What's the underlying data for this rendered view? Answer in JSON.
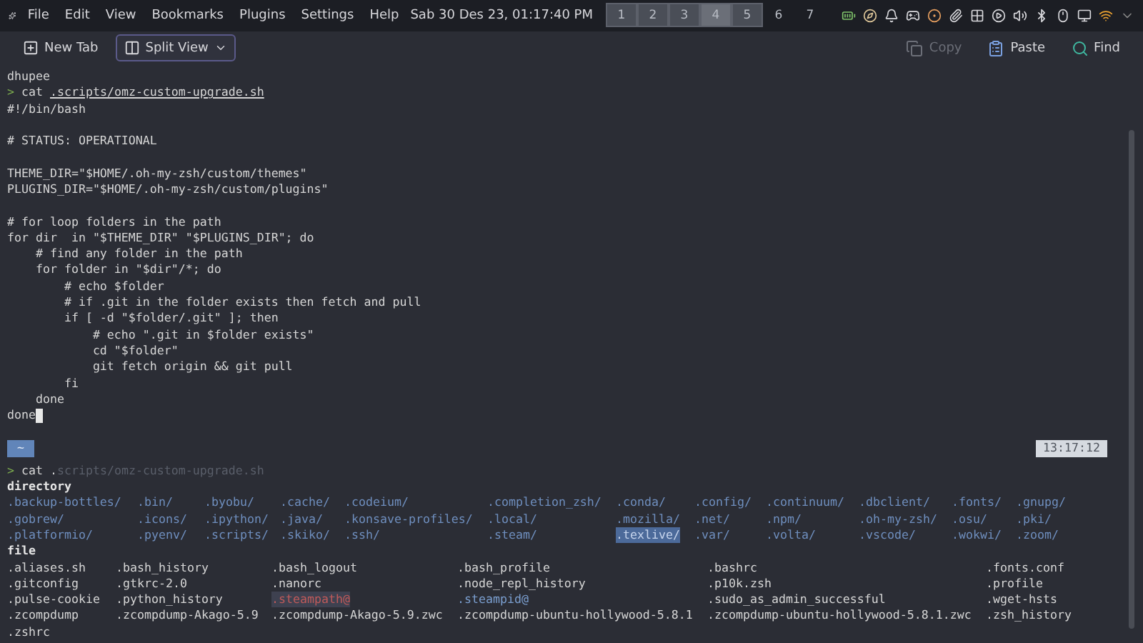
{
  "panel": {
    "menus": [
      "File",
      "Edit",
      "View",
      "Bookmarks",
      "Plugins",
      "Settings",
      "Help"
    ],
    "clock": "Sab 30 Des 23, 01:17:40 PM",
    "desktops": [
      {
        "label": "1",
        "occupied": true,
        "selected": false
      },
      {
        "label": "2",
        "occupied": true,
        "selected": false
      },
      {
        "label": "3",
        "occupied": true,
        "selected": false
      },
      {
        "label": "4",
        "occupied": true,
        "selected": true
      },
      {
        "label": "5",
        "occupied": true,
        "selected": false
      },
      {
        "label": "6",
        "occupied": false,
        "selected": false
      },
      {
        "label": "7",
        "occupied": false,
        "selected": false
      }
    ]
  },
  "toolbar": {
    "left": [
      {
        "label": "New Tab",
        "kind": "tab"
      },
      {
        "label": "Split View",
        "kind": "split"
      }
    ],
    "right": [
      {
        "label": "Copy",
        "kind": "copy",
        "disabled": true
      },
      {
        "label": "Paste",
        "kind": "paste",
        "disabled": false
      },
      {
        "label": "Find",
        "kind": "find",
        "disabled": false
      }
    ]
  },
  "terminal": {
    "user": "dhupee",
    "command": {
      "prompt": ">",
      "name": "cat",
      "argument": ".scripts/omz-custom-upgrade.sh"
    },
    "output": [
      [
        "#!/bin/bash"
      ],
      [
        "# STATUS: OPERATIONAL"
      ],
      [
        "THEME_DIR=\"$HOME/.oh-my-zsh/custom/themes\"",
        "PLUGINS_DIR=\"$HOME/.oh-my-zsh/custom/plugins\""
      ],
      [
        "# for loop folders in the path",
        "for dir  in \"$THEME_DIR\" \"$PLUGINS_DIR\"; do",
        "    # find any folder in the path",
        "    for folder in \"$dir\"/*; do",
        "        # echo $folder",
        "        # if .git in the folder exists then fetch and pull",
        "        if [ -d \"$folder/.git\" ]; then",
        "            # echo \".git in $folder exists\"",
        "            cd \"$folder\"",
        "            git fetch origin && git pull",
        "        fi",
        "    done",
        "done"
      ]
    ],
    "cursor": true,
    "path": "~",
    "time": "13:17:12",
    "next_command": {
      "prompt": ">",
      "name": "cat",
      "typed": ".",
      "suggestion": "scripts/omz-custom-upgrade.sh"
    },
    "directory_label": "directory",
    "directories": [
      {
        "name": ".backup-bottles/",
        "selected": false
      },
      {
        "name": ".bin/",
        "selected": false
      },
      {
        "name": ".byobu/",
        "selected": false
      },
      {
        "name": ".cache/",
        "selected": false
      },
      {
        "name": ".codeium/",
        "selected": false
      },
      {
        "name": ".completion_zsh/",
        "selected": false
      },
      {
        "name": ".conda/",
        "selected": false
      },
      {
        "name": ".config/",
        "selected": false
      },
      {
        "name": ".continuum/",
        "selected": false
      },
      {
        "name": ".dbclient/",
        "selected": false
      },
      {
        "name": ".fonts/",
        "selected": false
      },
      {
        "name": ".gnupg/",
        "selected": false
      },
      {
        "name": ".gobrew/",
        "selected": false
      },
      {
        "name": ".icons/",
        "selected": false
      },
      {
        "name": ".ipython/",
        "selected": false
      },
      {
        "name": ".java/",
        "selected": false
      },
      {
        "name": ".konsave-profiles/",
        "selected": false
      },
      {
        "name": ".local/",
        "selected": false
      },
      {
        "name": ".mozilla/",
        "selected": false
      },
      {
        "name": ".net/",
        "selected": false
      },
      {
        "name": ".npm/",
        "selected": false
      },
      {
        "name": ".oh-my-zsh/",
        "selected": false
      },
      {
        "name": ".osu/",
        "selected": false
      },
      {
        "name": ".pki/",
        "selected": false
      },
      {
        "name": ".platformio/",
        "selected": false
      },
      {
        "name": ".pyenv/",
        "selected": false
      },
      {
        "name": ".scripts/",
        "selected": false
      },
      {
        "name": ".skiko/",
        "selected": false
      },
      {
        "name": ".ssh/",
        "selected": false
      },
      {
        "name": ".steam/",
        "selected": false
      },
      {
        "name": ".texlive/",
        "selected": true
      },
      {
        "name": ".var/",
        "selected": false
      },
      {
        "name": ".volta/",
        "selected": false
      },
      {
        "name": ".vscode/",
        "selected": false
      },
      {
        "name": ".wokwi/",
        "selected": false
      },
      {
        "name": ".zoom/",
        "selected": false
      }
    ],
    "file_label": "file",
    "files": [
      {
        "name": ".aliases.sh",
        "kind": "file"
      },
      {
        "name": ".bash_history",
        "kind": "file"
      },
      {
        "name": ".bash_logout",
        "kind": "file"
      },
      {
        "name": ".bash_profile",
        "kind": "file"
      },
      {
        "name": ".bashrc",
        "kind": "file"
      },
      {
        "name": ".fonts.conf",
        "kind": "file"
      },
      {
        "name": ".gitconfig",
        "kind": "file"
      },
      {
        "name": ".gtkrc-2.0",
        "kind": "file"
      },
      {
        "name": ".nanorc",
        "kind": "file"
      },
      {
        "name": ".node_repl_history",
        "kind": "file"
      },
      {
        "name": ".p10k.zsh",
        "kind": "file"
      },
      {
        "name": ".profile",
        "kind": "file"
      },
      {
        "name": ".pulse-cookie",
        "kind": "file"
      },
      {
        "name": ".python_history",
        "kind": "file"
      },
      {
        "name": ".steampath@",
        "kind": "broken"
      },
      {
        "name": ".steampid@",
        "kind": "link"
      },
      {
        "name": ".sudo_as_admin_successful",
        "kind": "file"
      },
      {
        "name": ".wget-hsts",
        "kind": "file"
      },
      {
        "name": ".zcompdump",
        "kind": "file"
      },
      {
        "name": ".zcompdump-Akago-5.9",
        "kind": "file"
      },
      {
        "name": ".zcompdump-Akago-5.9.zwc",
        "kind": "file"
      },
      {
        "name": ".zcompdump-ubuntu-hollywood-5.8.1",
        "kind": "file"
      },
      {
        "name": ".zcompdump-ubuntu-hollywood-5.8.1.zwc",
        "kind": "file"
      },
      {
        "name": ".zsh_history",
        "kind": "file"
      },
      {
        "name": ".zshrc",
        "kind": "file"
      }
    ]
  }
}
